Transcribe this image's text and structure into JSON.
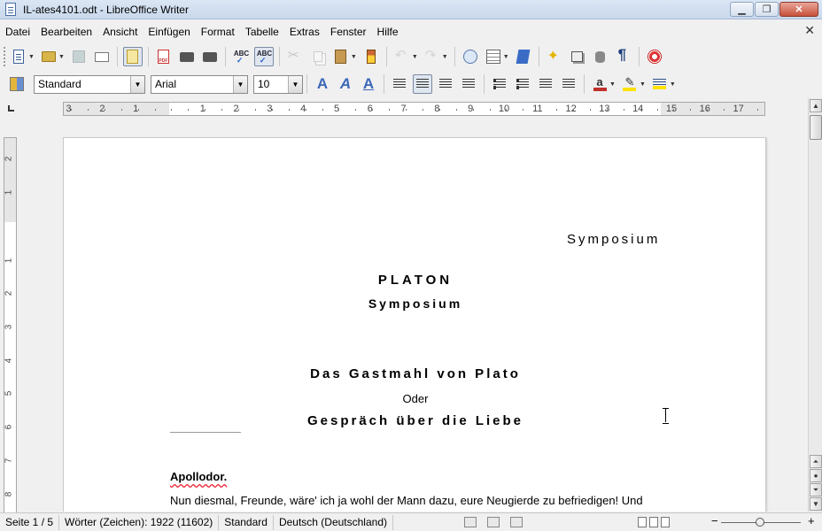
{
  "window": {
    "title": "IL-ates4101.odt - LibreOffice Writer",
    "minimize_label": "▁",
    "maximize_label": "❐",
    "close_label": "✕"
  },
  "menu": {
    "items": [
      "Datei",
      "Bearbeiten",
      "Ansicht",
      "Einfügen",
      "Format",
      "Tabelle",
      "Extras",
      "Fenster",
      "Hilfe"
    ],
    "close_doc": "✕"
  },
  "formatting": {
    "paragraph_style": "Standard",
    "font_name": "Arial",
    "font_size": "10"
  },
  "ruler": {
    "h_ticks": [
      "3",
      "2",
      "1",
      "1",
      "2",
      "3",
      "4",
      "5",
      "6",
      "7",
      "8",
      "9",
      "10",
      "11",
      "12",
      "13",
      "14",
      "15",
      "16",
      "17"
    ],
    "v_ticks": [
      "2",
      "1",
      "1",
      "2",
      "3",
      "4",
      "5",
      "6",
      "7",
      "8"
    ]
  },
  "document": {
    "header_title": "Symposium",
    "author": "PLATON",
    "work_title": "Symposium",
    "subtitle": "Das Gastmahl von Plato",
    "connector": "Oder",
    "subtitle2": "Gespräch über die Liebe",
    "speaker": "Apollodor.",
    "first_line": "Nun diesmal, Freunde, wäre' ich ja wohl der Mann dazu, eure Neugierde zu befriedigen! Und"
  },
  "status": {
    "page": "Seite 1 / 5",
    "words": "Wörter (Zeichen): 1922 (11602)",
    "page_style": "Standard",
    "language": "Deutsch (Deutschland)"
  },
  "icons": {
    "toolbar1": [
      "new-document-icon",
      "open-folder-icon",
      "save-icon",
      "email-icon",
      "edit-mode-icon",
      "export-pdf-icon",
      "print-icon",
      "print-preview-icon",
      "spellcheck-icon",
      "autospellcheck-icon",
      "cut-icon",
      "copy-icon",
      "paste-icon",
      "clone-format-icon",
      "undo-icon",
      "redo-icon",
      "navigator-icon",
      "table-icon",
      "show-draw-icon",
      "star-icon",
      "gallery-icon",
      "data-sources-icon",
      "formatting-marks-icon",
      "help-icon"
    ],
    "toolbar2": [
      "styles-icon",
      "font-name-icon",
      "bold-icon",
      "italic-icon",
      "outline-icon",
      "align-left-icon",
      "align-center-icon",
      "align-right-icon",
      "justify-icon",
      "numbered-list-icon",
      "bullet-list-icon",
      "decrease-indent-icon",
      "increase-indent-icon",
      "font-color-icon",
      "highlight-icon",
      "background-color-icon"
    ]
  },
  "colors": {
    "font_color": "#c0312b",
    "highlight": "#ffe200"
  }
}
